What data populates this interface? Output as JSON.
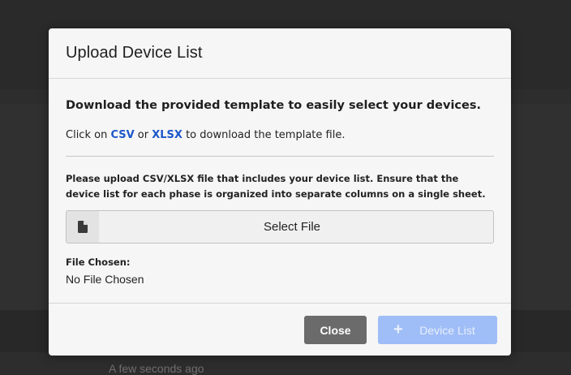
{
  "background": {
    "timestamp": "A few seconds ago"
  },
  "modal": {
    "title": "Upload Device List",
    "heading": "Download the provided template to easily select your devices.",
    "download_prefix": "Click on ",
    "csv_link": "CSV",
    "download_or": " or ",
    "xlsx_link": "XLSX",
    "download_suffix": " to download the template file.",
    "instructions": "Please upload CSV/XLSX file that includes your device list. Ensure that the device list for each phase is organized into separate columns on a single sheet.",
    "file_picker": {
      "icon": "file-icon",
      "label": "Select File"
    },
    "file_chosen_label": "File Chosen:",
    "file_chosen_value": "No File Chosen",
    "footer": {
      "close_label": "Close",
      "device_list_icon": "plus-icon",
      "device_list_label": "Device List"
    }
  },
  "colors": {
    "link": "#1b57c9",
    "close_button": "#6b6b6b",
    "primary_button_disabled": "#9fbdf7",
    "modal_background": "#f6f6f6",
    "overlay": "#2d2d2d"
  }
}
